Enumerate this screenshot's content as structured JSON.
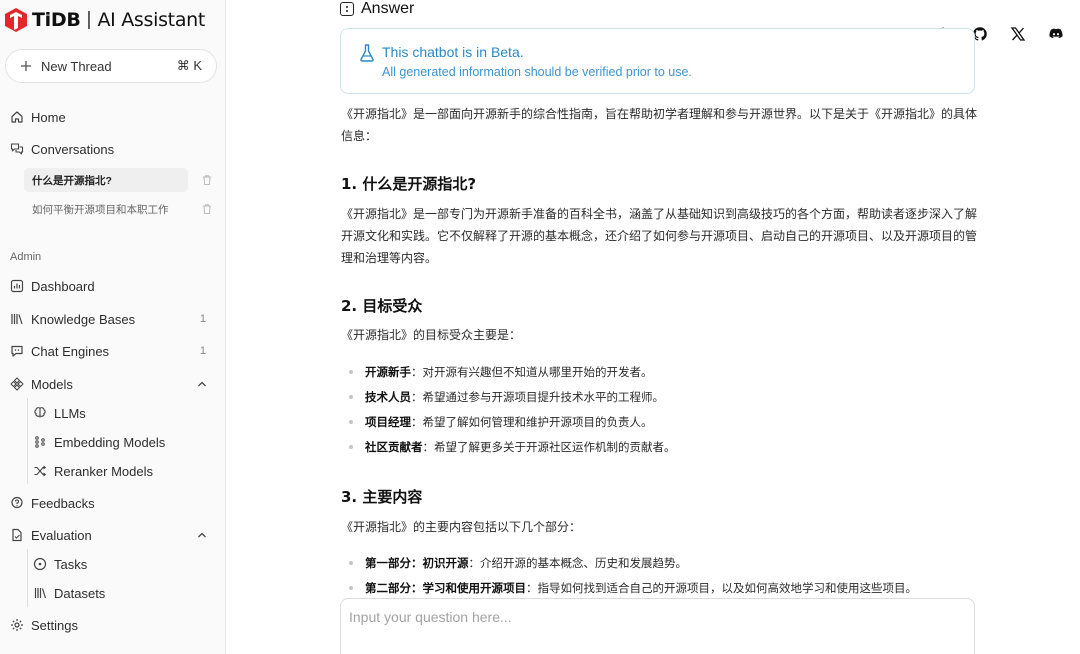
{
  "brand": {
    "name": "TiDB",
    "separator": "|",
    "product": "AI Assistant"
  },
  "sidebar": {
    "new_thread": {
      "label": "New Thread",
      "shortcut": "⌘ K"
    },
    "home": "Home",
    "conversations": "Conversations",
    "threads": [
      {
        "title": "什么是开源指北?",
        "active": true
      },
      {
        "title": "如何平衡开源项目和本职工作",
        "active": false
      }
    ],
    "admin_label": "Admin",
    "dashboard": "Dashboard",
    "knowledge_bases": {
      "label": "Knowledge Bases",
      "count": "1"
    },
    "chat_engines": {
      "label": "Chat Engines",
      "count": "1"
    },
    "models": {
      "label": "Models",
      "children": [
        "LLMs",
        "Embedding Models",
        "Reranker Models"
      ]
    },
    "feedbacks": "Feedbacks",
    "evaluation": {
      "label": "Evaluation",
      "children": [
        "Tasks",
        "Datasets"
      ]
    },
    "settings": "Settings"
  },
  "topbar_icons": [
    "sun-icon",
    "github-icon",
    "x-icon",
    "discord-icon"
  ],
  "answer": {
    "heading": "Answer",
    "beta_title": "This chatbot is in Beta.",
    "beta_text": "All generated information should be verified prior to use.",
    "intro": "《开源指北》是一部面向开源新手的综合性指南，旨在帮助初学者理解和参与开源世界。以下是关于《开源指北》的具体信息：",
    "sections": [
      {
        "title": "1. 什么是开源指北?",
        "text": "《开源指北》是一部专门为开源新手准备的百科全书，涵盖了从基础知识到高级技巧的各个方面，帮助读者逐步深入了解开源文化和实践。它不仅解释了开源的基本概念，还介绍了如何参与开源项目、启动自己的开源项目、以及开源项目的管理和治理等内容。"
      },
      {
        "title": "2. 目标受众",
        "text": "《开源指北》的目标受众主要是：",
        "items": [
          {
            "term": "开源新手",
            "desc": "：对开源有兴趣但不知道从哪里开始的开发者。"
          },
          {
            "term": "技术人员",
            "desc": "：希望通过参与开源项目提升技术水平的工程师。"
          },
          {
            "term": "项目经理",
            "desc": "：希望了解如何管理和维护开源项目的负责人。"
          },
          {
            "term": "社区贡献者",
            "desc": "：希望了解更多关于开源社区运作机制的贡献者。"
          }
        ]
      },
      {
        "title": "3. 主要内容",
        "text": "《开源指北》的主要内容包括以下几个部分：",
        "items": [
          {
            "term": "第一部分：初识开源",
            "desc": "：介绍开源的基本概念、历史和发展趋势。"
          },
          {
            "term": "第二部分：学习和使用开源项目",
            "desc": "：指导如何找到适合自己的开源项目，以及如何高效地学习和使用这些项目。"
          }
        ]
      }
    ]
  },
  "input": {
    "placeholder": "Input your question here..."
  }
}
